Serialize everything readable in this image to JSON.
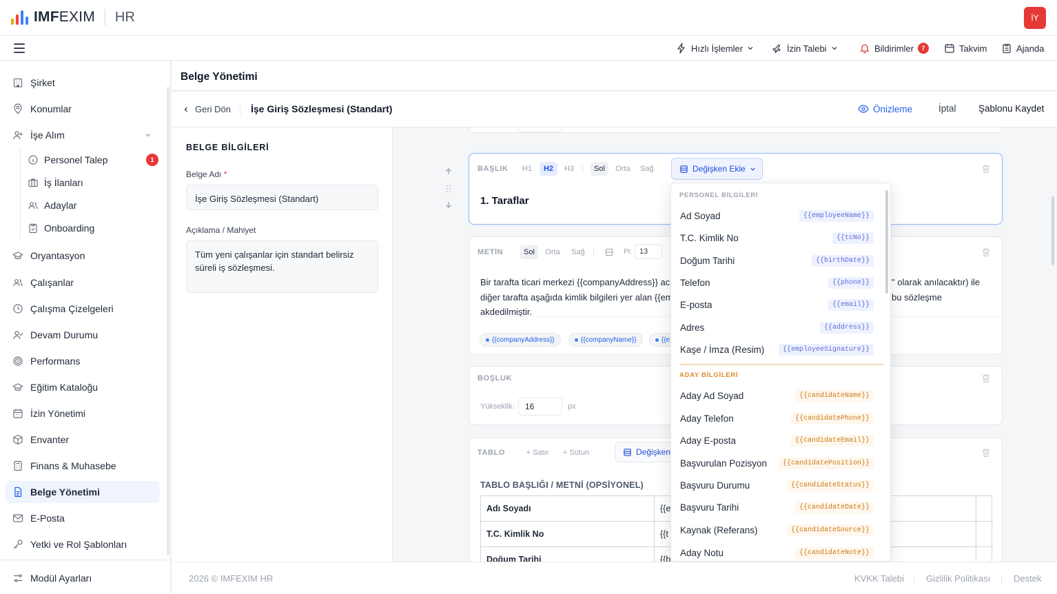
{
  "brand": {
    "name_bold": "IMF",
    "name_rest": "EXIM",
    "module": "HR",
    "bar_colors": [
      "#f59e0b",
      "#ef4444",
      "#3b82f6",
      "#3b82f6"
    ]
  },
  "user": {
    "initials": "İY",
    "color": "#e53935"
  },
  "topnav": {
    "quick_actions": "Hızlı İşlemler",
    "leave_request": "İzin Talebi",
    "notifications": "Bildirimler",
    "notifications_count": "7",
    "calendar": "Takvim",
    "agenda": "Ajanda"
  },
  "sidebar": {
    "items": [
      {
        "label": "Şirket",
        "icon": "building-icon"
      },
      {
        "label": "Konumlar",
        "icon": "location-pin-icon"
      },
      {
        "label": "İşe Alım",
        "icon": "user-plus-icon"
      },
      {
        "label": "Oryantasyon",
        "icon": "graduation-cap-icon"
      },
      {
        "label": "Çalışanlar",
        "icon": "users-icon"
      },
      {
        "label": "Çalışma Çizelgeleri",
        "icon": "clock-icon"
      },
      {
        "label": "Devam Durumu",
        "icon": "user-check-icon"
      },
      {
        "label": "Performans",
        "icon": "target-icon"
      },
      {
        "label": "Eğitim Kataloğu",
        "icon": "graduation-cap-icon"
      },
      {
        "label": "İzin Yönetimi",
        "icon": "calendar-icon"
      },
      {
        "label": "Envanter",
        "icon": "box-icon"
      },
      {
        "label": "Finans & Muhasebe",
        "icon": "calculator-icon"
      },
      {
        "label": "Belge Yönetimi",
        "icon": "document-icon"
      },
      {
        "label": "E-Posta",
        "icon": "mail-icon"
      },
      {
        "label": "Yetki ve Rol Şablonları",
        "icon": "key-icon"
      }
    ],
    "sub_items": [
      {
        "label": "Personel Talep",
        "badge": "1"
      },
      {
        "label": "İş İlanları"
      },
      {
        "label": "Adaylar"
      },
      {
        "label": "Onboarding"
      }
    ],
    "settings": "Modül Ayarları"
  },
  "page": {
    "title": "Belge Yönetimi"
  },
  "editor": {
    "back": "Geri Dön",
    "doc_title": "İşe Giriş Sözleşmesi (Standart)",
    "preview": "Önizleme",
    "cancel": "İptal",
    "save": "Şablonu Kaydet"
  },
  "doc_info": {
    "section_title": "BELGE BİLGİLERİ",
    "name_label": "Belge Adı",
    "required_mark": "*",
    "name_value": "İşe Giriş Sözleşmesi (Standart)",
    "desc_label": "Açıklama / Mahiyet",
    "desc_value": "Tüm yeni çalışanlar için standart belirsiz süreli iş sözleşmesi."
  },
  "blocks": {
    "heading": {
      "label": "BAŞLIK",
      "levels": [
        "H1",
        "H2",
        "H3"
      ],
      "active_level": "H2",
      "align": [
        "Sol",
        "Orta",
        "Sağ"
      ],
      "active_align": "Sol",
      "add_variable": "Değişken Ekle",
      "text": "1. Taraflar"
    },
    "text": {
      "label": "METİN",
      "align": [
        "Sol",
        "Orta",
        "Sağ"
      ],
      "active_align": "Sol",
      "pt_label": "Pt:",
      "pt_value": "13",
      "line1_left": "Bir tarafta ticari merkezi {{companyAddress}} ac",
      "line1_right": "\" olarak anılacaktır) ile",
      "line2_left": "diğer tarafta aşağıda kimlik bilgileri yer alan {{em",
      "line2_right": "bu sözleşme",
      "line3_left": "akdedilmiştir.",
      "pills": [
        "{{companyAddress}}",
        "{{companyName}}",
        "{{e"
      ]
    },
    "spacer": {
      "label": "BOŞLUK",
      "height_label": "Yükseklik:",
      "height_value": "16",
      "unit": "px"
    },
    "table": {
      "label": "TABLO",
      "add_row": "+ Satır",
      "add_col": "+ Sütun",
      "add_variable": "Değişken",
      "caption": "TABLO BAŞLIĞI / METNİ (OPSİYONEL)",
      "rows": [
        {
          "label": "Adı Soyadı",
          "value": "{{e"
        },
        {
          "label": "T.C. Kimlik No",
          "value": "{{t"
        },
        {
          "label": "Doğum Tarihi",
          "value": "{{b"
        }
      ]
    }
  },
  "variable_menu": {
    "personnel_title": "PERSONEL BİLGİLERİ",
    "personnel": [
      {
        "label": "Ad Soyad",
        "var": "{{employeeName}}"
      },
      {
        "label": "T.C. Kimlik No",
        "var": "{{tcNo}}"
      },
      {
        "label": "Doğum Tarihi",
        "var": "{{birthDate}}"
      },
      {
        "label": "Telefon",
        "var": "{{phone}}"
      },
      {
        "label": "E-posta",
        "var": "{{email}}"
      },
      {
        "label": "Adres",
        "var": "{{address}}"
      },
      {
        "label": "Kaşe / İmza (Resim)",
        "var": "{{employeeSignature}}"
      }
    ],
    "candidate_title": "ADAY BİLGİLERİ",
    "candidate": [
      {
        "label": "Aday Ad Soyad",
        "var": "{{candidateName}}"
      },
      {
        "label": "Aday Telefon",
        "var": "{{candidatePhone}}"
      },
      {
        "label": "Aday E-posta",
        "var": "{{candidateEmail}}"
      },
      {
        "label": "Başvurulan Pozisyon",
        "var": "{{candidatePosition}}"
      },
      {
        "label": "Başvuru Durumu",
        "var": "{{candidateStatus}}"
      },
      {
        "label": "Başvuru Tarihi",
        "var": "{{candidateDate}}"
      },
      {
        "label": "Kaynak (Referans)",
        "var": "{{candidateSource}}"
      },
      {
        "label": "Aday Notu",
        "var": "{{candidateNote}}"
      }
    ]
  },
  "footer": {
    "copyright": "2026 © IMFEXIM HR",
    "links": [
      "KVKK Talebi",
      "Gizlilik Politikası",
      "Destek"
    ]
  },
  "colors": {
    "accent": "#2563eb",
    "danger": "#e53935",
    "candidate": "#e0892b",
    "personnel": "#9ca3af"
  }
}
